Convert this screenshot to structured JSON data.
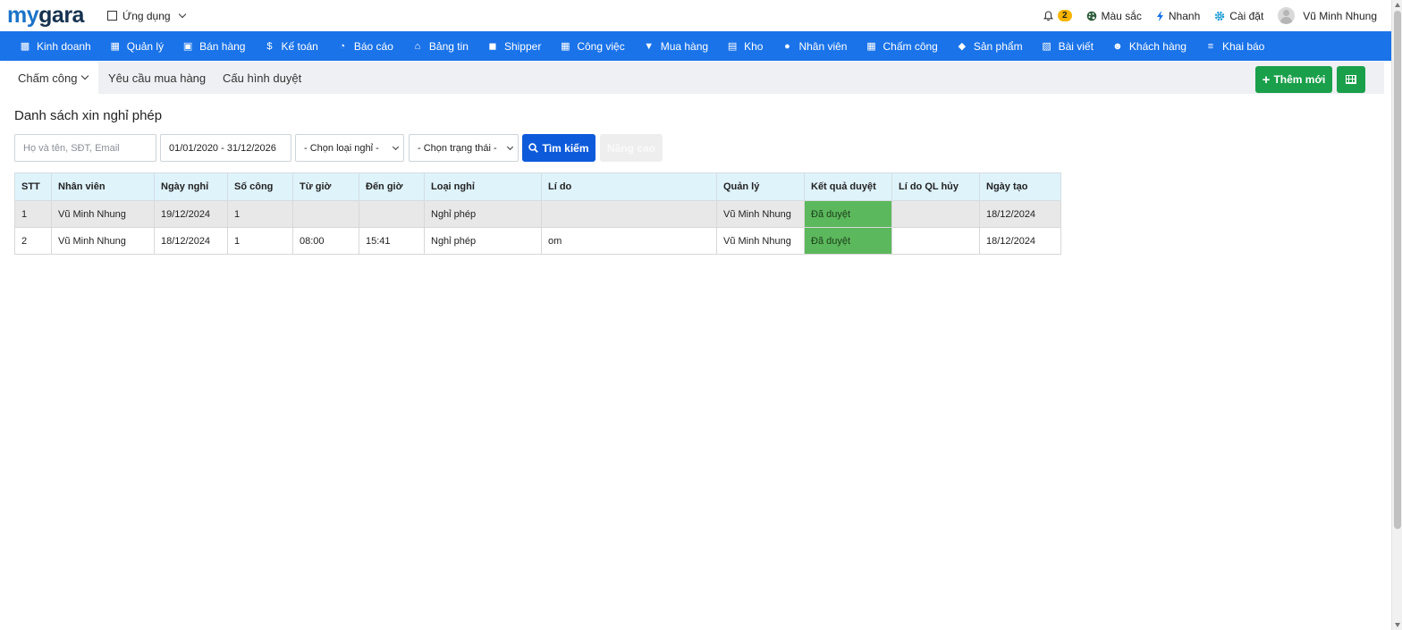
{
  "header": {
    "logo_my": "my",
    "logo_gara": "gara",
    "apps_label": "Ứng dụng",
    "notif_count": "2",
    "color_label": "Màu sắc",
    "quick_label": "Nhanh",
    "settings_label": "Cài đặt",
    "user_name": "Vũ Minh Nhung"
  },
  "nav": {
    "items": [
      {
        "label": "Kinh doanh",
        "icon": "bag-icon"
      },
      {
        "label": "Quản lý",
        "icon": "id-card-icon"
      },
      {
        "label": "Bán hàng",
        "icon": "cart-icon"
      },
      {
        "label": "Kế toán",
        "icon": "dollar-icon"
      },
      {
        "label": "Báo cáo",
        "icon": "pie-chart-icon"
      },
      {
        "label": "Bảng tin",
        "icon": "home-icon"
      },
      {
        "label": "Shipper",
        "icon": "truck-icon"
      },
      {
        "label": "Công việc",
        "icon": "calendar-icon"
      },
      {
        "label": "Mua hàng",
        "icon": "basket-icon"
      },
      {
        "label": "Kho",
        "icon": "warehouse-icon"
      },
      {
        "label": "Nhân viên",
        "icon": "user-icon"
      },
      {
        "label": "Chấm công",
        "icon": "calendar-icon"
      },
      {
        "label": "Sản phẩm",
        "icon": "box-icon"
      },
      {
        "label": "Bài viết",
        "icon": "newspaper-icon"
      },
      {
        "label": "Khách hàng",
        "icon": "smile-icon"
      },
      {
        "label": "Khai báo",
        "icon": "list-icon"
      }
    ]
  },
  "tabs": {
    "timekeeping": "Chấm công",
    "purchase_request": "Yêu cầu mua hàng",
    "approval_config": "Cấu hình duyệt"
  },
  "actions": {
    "add_new": "Thêm mới"
  },
  "page": {
    "title": "Danh sách xin nghỉ phép"
  },
  "filters": {
    "search_placeholder": "Họ và tên, SĐT, Email",
    "date_range": "01/01/2020 - 31/12/2026",
    "leave_type": "- Chọn loại nghỉ -",
    "status": "- Chọn trạng thái -",
    "search_button": "Tìm kiếm",
    "advanced_button": "Nâng cao"
  },
  "table": {
    "headers": [
      "STT",
      "Nhân viên",
      "Ngày nghỉ",
      "Số công",
      "Từ giờ",
      "Đến giờ",
      "Loại nghỉ",
      "Lí do",
      "Quản lý",
      "Kết quả duyệt",
      "Lí do QL hủy",
      "Ngày tạo"
    ],
    "rows": [
      [
        "1",
        "Vũ Minh Nhung",
        "19/12/2024",
        "1",
        "",
        "",
        "Nghỉ phép",
        "",
        "Vũ Minh Nhung",
        "Đã duyệt",
        "",
        "18/12/2024"
      ],
      [
        "2",
        "Vũ Minh Nhung",
        "18/12/2024",
        "1",
        "08:00",
        "15:41",
        "Nghỉ phép",
        "om",
        "Vũ Minh Nhung",
        "Đã duyệt",
        "",
        "18/12/2024"
      ]
    ]
  },
  "colors": {
    "nav_bg": "#1a73e8",
    "success": "#1a9f4b",
    "approved": "#5cb85c",
    "primary": "#0d5bdb"
  }
}
